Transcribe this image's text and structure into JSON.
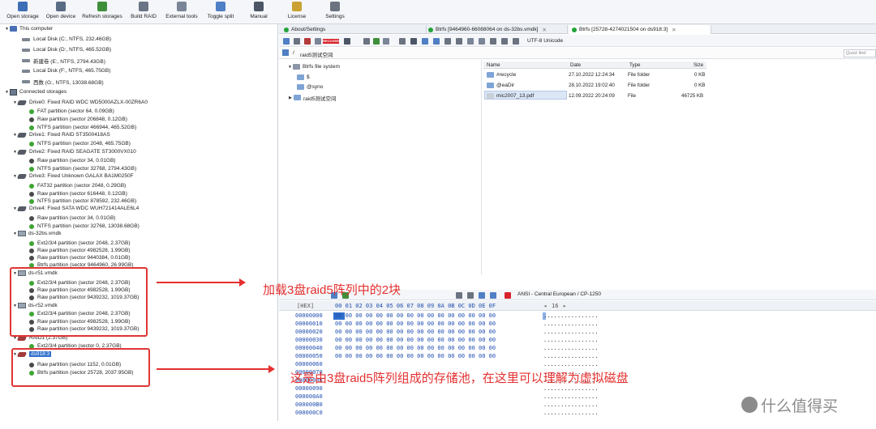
{
  "toolbar": {
    "buttons": [
      {
        "label": "Open storage",
        "icon": "open-storage-icon",
        "color": "#3d6fb6"
      },
      {
        "label": "Open device",
        "icon": "open-device-icon",
        "color": "#5a6b84"
      },
      {
        "label": "Refresh storages",
        "icon": "refresh-icon",
        "color": "#3f8f3a"
      },
      {
        "label": "Build RAID",
        "icon": "raid-icon",
        "color": "#6a7486"
      },
      {
        "label": "External tools",
        "icon": "tools-icon",
        "color": "#7a8597"
      },
      {
        "label": "Toggle split",
        "icon": "split-icon",
        "color": "#4f7fc4"
      },
      {
        "label": "Manual",
        "icon": "manual-icon",
        "color": "#4c5566"
      },
      {
        "label": "License",
        "icon": "license-icon",
        "color": "#c9a233"
      },
      {
        "label": "Settings",
        "icon": "gear-icon",
        "color": "#6b7280"
      }
    ]
  },
  "tree": {
    "this_computer": "This computer",
    "local_disks": [
      "Local Disk (C:, NTFS, 232.46GB)",
      "Local Disk (D:, NTFS, 465.52GB)",
      "新建卷 (E:, NTFS, 2794.43GB)",
      "Local Disk (F:, NTFS, 465.75GB)",
      "西数 (G:, NTFS, 13038.68GB)"
    ],
    "connected_storages": "Connected storages",
    "drives": [
      {
        "label": "Drive0: Fixed RAID WDC WD5000AZLX-00ZR6A0",
        "parts": [
          {
            "label": "FAT partition (sector 64, 0.09GB)",
            "color": "green"
          },
          {
            "label": "Raw partition (sector 206848, 0.12GB)",
            "color": "dark"
          },
          {
            "label": "NTFS partition (sector 466944, 465.52GB)",
            "color": "green"
          }
        ]
      },
      {
        "label": "Drive1: Fixed RAID ST3500418AS",
        "parts": [
          {
            "label": "NTFS partition (sector 2048, 465.75GB)",
            "color": "green"
          }
        ]
      },
      {
        "label": "Drive2: Fixed RAID SEAGATE  ST3000VX010",
        "parts": [
          {
            "label": "Raw partition (sector 34, 0.01GB)",
            "color": "dark"
          },
          {
            "label": "NTFS partition (sector 32768, 2794.43GB)",
            "color": "green"
          }
        ]
      },
      {
        "label": "Drive3: Fixed Unknown GALAX BA1M0250F",
        "parts": [
          {
            "label": "FAT32 partition (sector 2048, 0.29GB)",
            "color": "green"
          },
          {
            "label": "Raw partition (sector 616448, 0.12GB)",
            "color": "dark"
          },
          {
            "label": "NTFS partition (sector 878592, 232.46GB)",
            "color": "green"
          }
        ]
      },
      {
        "label": "Drive4: Fixed SATA WDC  WUH721414ALE6L4",
        "parts": [
          {
            "label": "Raw partition (sector 34, 0.01GB)",
            "color": "dark"
          },
          {
            "label": "NTFS partition (sector 32768, 13038.68GB)",
            "color": "green"
          }
        ]
      },
      {
        "label": "ds-32bs.vmdk",
        "parts": [
          {
            "label": "Ext2/3/4 partition (sector 2048, 2.37GB)",
            "color": "green"
          },
          {
            "label": "Raw partition (sector 4982528, 1.99GB)",
            "color": "dark"
          },
          {
            "label": "Raw partition (sector 9440384, 0.01GB)",
            "color": "dark"
          },
          {
            "label": "Btrfs partition (sector 9464960, 26.99GB)",
            "color": "green"
          }
        ]
      },
      {
        "label": "ds-r51.vmdk",
        "parts": [
          {
            "label": "Ext2/3/4 partition (sector 2048, 2.37GB)",
            "color": "green"
          },
          {
            "label": "Raw partition (sector 4982528, 1.99GB)",
            "color": "dark"
          },
          {
            "label": "Raw partition (sector 9439232, 1019.37GB)",
            "color": "dark"
          }
        ]
      },
      {
        "label": "ds-r52.vmdk",
        "parts": [
          {
            "label": "Ext2/3/4 partition (sector 2048, 2.37GB)",
            "color": "green"
          },
          {
            "label": "Raw partition (sector 4982528, 1.99GB)",
            "color": "dark"
          },
          {
            "label": "Raw partition (sector 9439232, 1019.37GB)",
            "color": "dark"
          }
        ]
      },
      {
        "label": "RAID1 (2.37GB)",
        "parts": [
          {
            "label": "Ext2/3/4 partition (sector 0, 2.37GB)",
            "color": "green"
          }
        ]
      },
      {
        "label": "ds918:3",
        "parts": [
          {
            "label": "Raw partition (sector 1152, 0.01GB)",
            "color": "dark"
          },
          {
            "label": "Btrfs partition (sector 25728, 2037.95GB)",
            "color": "green"
          }
        ]
      }
    ]
  },
  "tabs": [
    {
      "label": "About/Settings",
      "closable": false
    },
    {
      "label": "Btrfs [9464960-66088064 on ds-32bs.vmdk]",
      "closable": true
    },
    {
      "label": "Btrfs [25728-4274021504 on ds918:3]",
      "closable": true
    }
  ],
  "browser": {
    "recover_label": "RECOVER",
    "encoding": "UTF-8 Unicode",
    "path": "raid5测试空间",
    "path_root": "/",
    "quick_find_placeholder": "Quick find",
    "fs_root": "Btrfs file system",
    "fs_items": [
      "$",
      "@syno",
      "raid5测试空间"
    ]
  },
  "file_list": {
    "columns": [
      "Name",
      "Date",
      "Type",
      "Size"
    ],
    "rows": [
      {
        "name": "#recycle",
        "date": "27.10.2022 12:24:34",
        "type": "File folder",
        "size": "0 KB"
      },
      {
        "name": "@eaDir",
        "date": "28.10.2022 19:02:40",
        "type": "File folder",
        "size": "0 KB"
      },
      {
        "name": "mic2007_13.pdf",
        "date": "12.09.2022 20:24:09",
        "type": "File",
        "size": "46725 KB"
      }
    ]
  },
  "hex": {
    "encoding": "ANSI - Central European / CP-1250",
    "mode": "[HEX]",
    "columns": "00 01 02 03 04 05 06 07 08 09 0A 0B 0C 0D 0E 0F",
    "width": "16",
    "addresses": [
      "00000000",
      "00000010",
      "00000020",
      "00000030",
      "00000040",
      "00000050",
      "00000060",
      "00000070",
      "00000080",
      "00000090",
      "000000A0",
      "000000B0",
      "000000C0"
    ],
    "byte_row": "00 00 00 00 00 00 00 00 00 00 00 00 00 00 00 00",
    "ascii_row": "................"
  },
  "annotations": {
    "text1": "加载3盘raid5阵列中的2块",
    "text2": "这是由3盘raid5阵列组成的存储池，在这里可以理解为虚拟磁盘",
    "color": "#e53030"
  },
  "watermark": "什么值得买"
}
